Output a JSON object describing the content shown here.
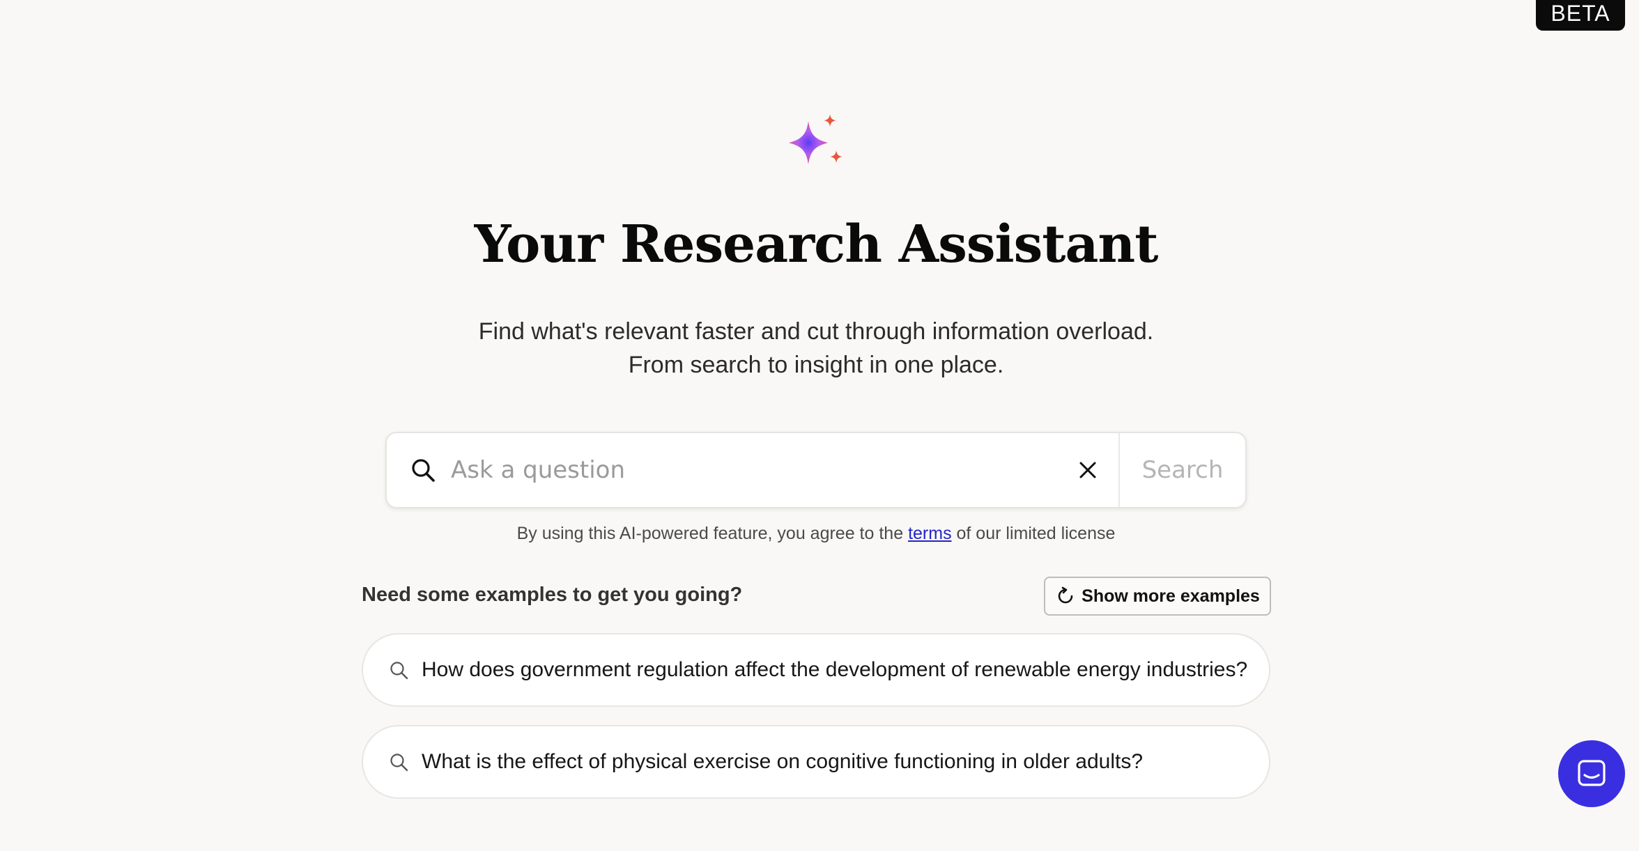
{
  "badge": {
    "label": "BETA"
  },
  "hero": {
    "icon": "sparkle-icon",
    "title": "Your Research Assistant",
    "subtitle_line1": "Find what's relevant faster and cut through information overload.",
    "subtitle_line2": "From search to insight in one place."
  },
  "search": {
    "placeholder": "Ask a question",
    "value": "",
    "button_label": "Search",
    "icon": "search-icon",
    "clear_icon": "close-icon"
  },
  "disclaimer": {
    "prefix": "By using this AI-powered feature, you agree to the",
    "link_text": "terms",
    "suffix": "of our limited license"
  },
  "examples": {
    "heading": "Need some examples to get you going?",
    "more_button_label": "Show more examples",
    "items": [
      {
        "text": "How does government regulation affect the development of renewable energy industries?"
      },
      {
        "text": "What is the effect of physical exercise on cognitive functioning in older adults?"
      }
    ]
  },
  "chat": {
    "icon": "chat-icon"
  },
  "colors": {
    "background": "#f9f8f6",
    "accent": "#3a2fe0",
    "link": "#2424c8",
    "sparkle_orange": "#e8573d",
    "sparkle_purple": "#6a3cf0",
    "sparkle_pink": "#f25a9c"
  }
}
